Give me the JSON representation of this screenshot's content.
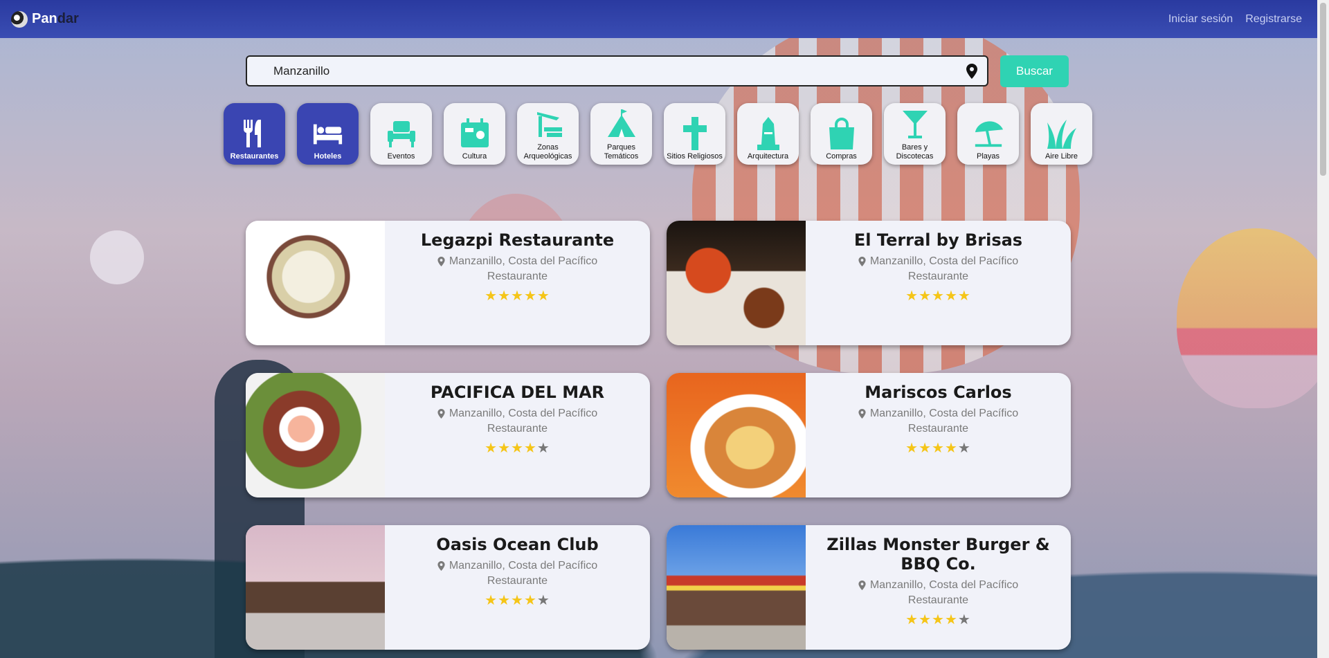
{
  "header": {
    "brand_part1": "Pan",
    "brand_part2": "dar",
    "login": "Iniciar sesión",
    "register": "Registrarse"
  },
  "search": {
    "value": "Manzanillo",
    "button": "Buscar"
  },
  "categories": [
    {
      "label": "Restaurantes",
      "icon": "utensils-icon",
      "active": true
    },
    {
      "label": "Hoteles",
      "icon": "bed-icon",
      "active": true
    },
    {
      "label": "Eventos",
      "icon": "chair-icon",
      "active": false
    },
    {
      "label": "Cultura",
      "icon": "theater-icon",
      "active": false
    },
    {
      "label": "Zonas Arqueológicas",
      "icon": "ruins-icon",
      "active": false
    },
    {
      "label": "Parques Temáticos",
      "icon": "tent-icon",
      "active": false
    },
    {
      "label": "Sitios Religiosos",
      "icon": "cross-icon",
      "active": false
    },
    {
      "label": "Arquitectura",
      "icon": "monument-icon",
      "active": false
    },
    {
      "label": "Compras",
      "icon": "shopping-bag-icon",
      "active": false
    },
    {
      "label": "Bares y Discotecas",
      "icon": "cocktail-icon",
      "active": false
    },
    {
      "label": "Playas",
      "icon": "umbrella-beach-icon",
      "active": false
    },
    {
      "label": "Aire Libre",
      "icon": "grass-icon",
      "active": false
    }
  ],
  "places": [
    {
      "name": "Legazpi Restaurante",
      "location": "Manzanillo, Costa del Pacífico",
      "type": "Restaurante",
      "rating": 5
    },
    {
      "name": "El Terral by Brisas",
      "location": "Manzanillo, Costa del Pacífico",
      "type": "Restaurante",
      "rating": 5
    },
    {
      "name": "PACIFICA DEL MAR",
      "location": "Manzanillo, Costa del Pacífico",
      "type": "Restaurante",
      "rating": 4
    },
    {
      "name": "Mariscos Carlos",
      "location": "Manzanillo, Costa del Pacífico",
      "type": "Restaurante",
      "rating": 4
    },
    {
      "name": "Oasis Ocean Club",
      "location": "Manzanillo, Costa del Pacífico",
      "type": "Restaurante",
      "rating": 4
    },
    {
      "name": "Zillas Monster Burger & BBQ Co.",
      "location": "Manzanillo, Costa del Pacífico",
      "type": "Restaurante",
      "rating": 4
    }
  ],
  "colors": {
    "header": "#3040a8",
    "accent": "#2fd3b3",
    "active_category": "#3a45b2",
    "star": "#f5c518"
  }
}
